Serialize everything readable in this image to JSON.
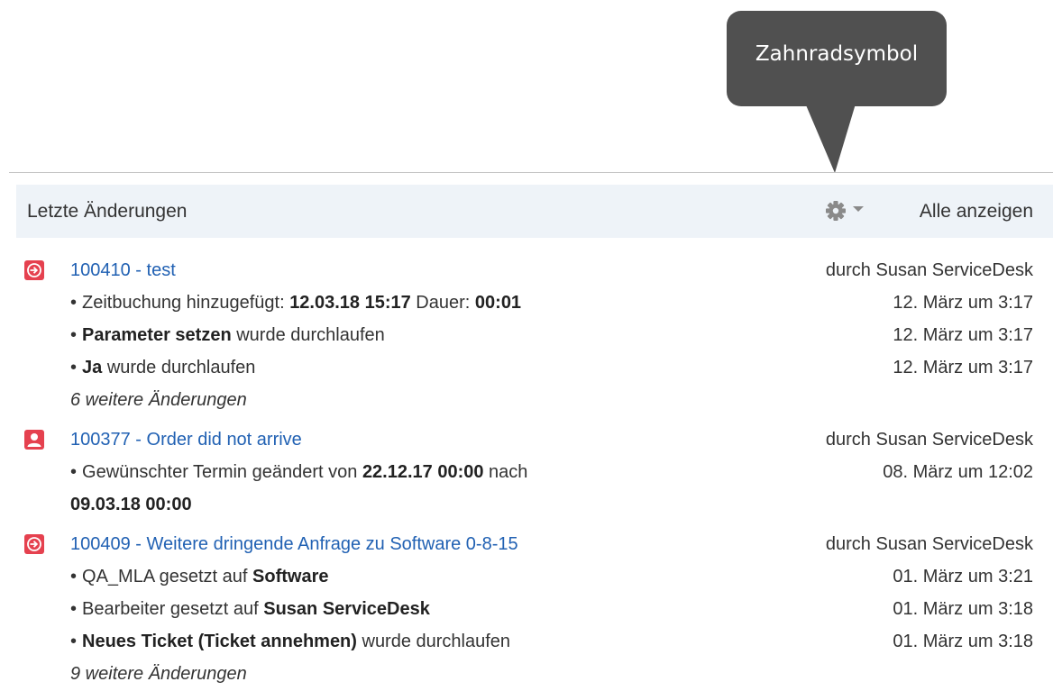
{
  "tooltip": {
    "label": "Zahnradsymbol"
  },
  "panel": {
    "title": "Letzte Änderungen",
    "settings_icon": "gear-icon",
    "dropdown_icon": "caret-down-icon",
    "show_all_label": "Alle anzeigen"
  },
  "tickets": [
    {
      "icon": "process-arrow-icon",
      "link": "100410 - test",
      "by": "durch Susan ServiceDesk",
      "changes": [
        {
          "parts": [
            "Zeitbuchung hinzugefügt: ",
            "12.03.18 15:17",
            " Dauer: ",
            "00:01"
          ],
          "time": "12. März um 3:17"
        },
        {
          "parts": [
            "Parameter setzen",
            " wurde durchlaufen"
          ],
          "time": "12. März um 3:17"
        },
        {
          "parts": [
            "Ja",
            " wurde durchlaufen"
          ],
          "time": "12. März um 3:17"
        }
      ],
      "more": "6 weitere Änderungen"
    },
    {
      "icon": "user-icon",
      "link": "100377 - Order did not arrive",
      "by": "durch Susan ServiceDesk",
      "changes": [
        {
          "parts": [
            "Gewünschter Termin geändert von ",
            "22.12.17 00:00",
            " nach"
          ],
          "continuation": "09.03.18 00:00",
          "time": "08. März um 12:02"
        }
      ]
    },
    {
      "icon": "process-arrow-icon",
      "link": "100409 - Weitere dringende Anfrage zu Software 0-8-15",
      "by": "durch Susan ServiceDesk",
      "changes": [
        {
          "parts": [
            "QA_MLA gesetzt auf ",
            "Software"
          ],
          "time": "01. März um 3:21"
        },
        {
          "parts": [
            "Bearbeiter gesetzt auf ",
            "Susan ServiceDesk"
          ],
          "time": "01. März um 3:18"
        },
        {
          "parts": [
            "Neues Ticket (Ticket annehmen)",
            " wurde durchlaufen"
          ],
          "time": "01. März um 3:18"
        }
      ],
      "more": "9 weitere Änderungen"
    }
  ]
}
